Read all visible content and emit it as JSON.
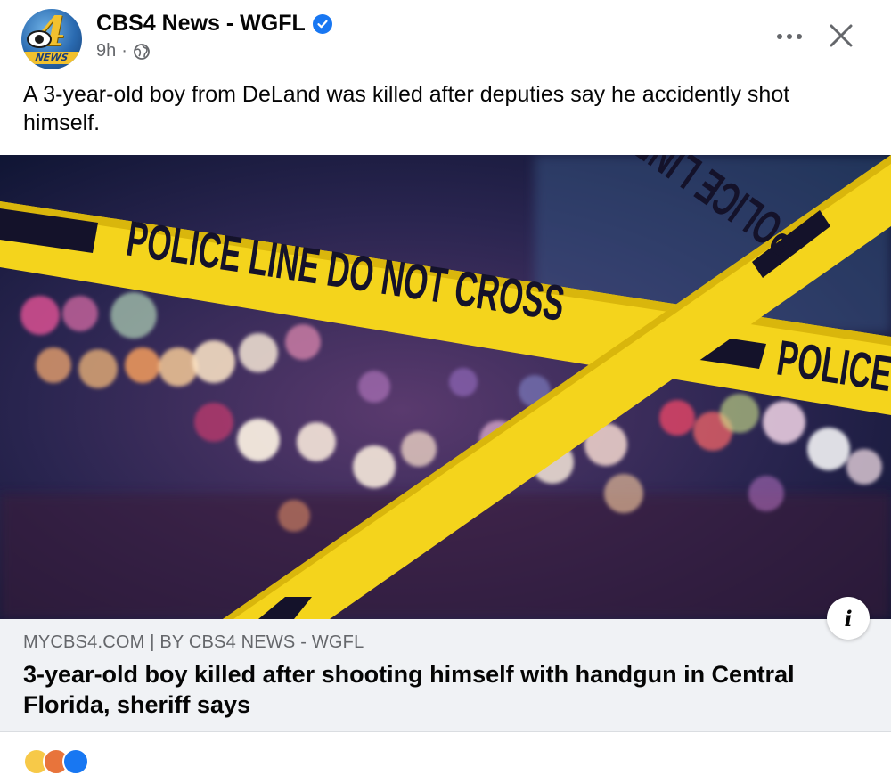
{
  "post": {
    "page_name": "CBS4 News - WGFL",
    "time": "9h",
    "separator": "·",
    "caption": "A 3-year-old boy from DeLand was killed after deputies say he accidently shot himself."
  },
  "avatar": {
    "numeral": "4",
    "text": "NEWS"
  },
  "image": {
    "tape_texts": [
      "POLICE LINE DO NOT CROSS",
      "POLICE LINE DO NOT CROSS",
      "POLICE"
    ],
    "colors": {
      "tape": "#f4d41c",
      "tape_text": "#14122a"
    }
  },
  "link": {
    "domain": "MYCBS4.COM | BY CBS4 NEWS - WGFL",
    "headline": "3-year-old boy killed after shooting himself with handgun in Central Florida, sheriff says",
    "info_label": "i"
  },
  "icons": [
    "verified-badge-icon",
    "globe-icon",
    "more-options-icon",
    "close-icon",
    "info-icon"
  ],
  "colors": {
    "verified": "#1877f2",
    "link_background": "#f0f2f5",
    "secondary_text": "#65676b"
  }
}
